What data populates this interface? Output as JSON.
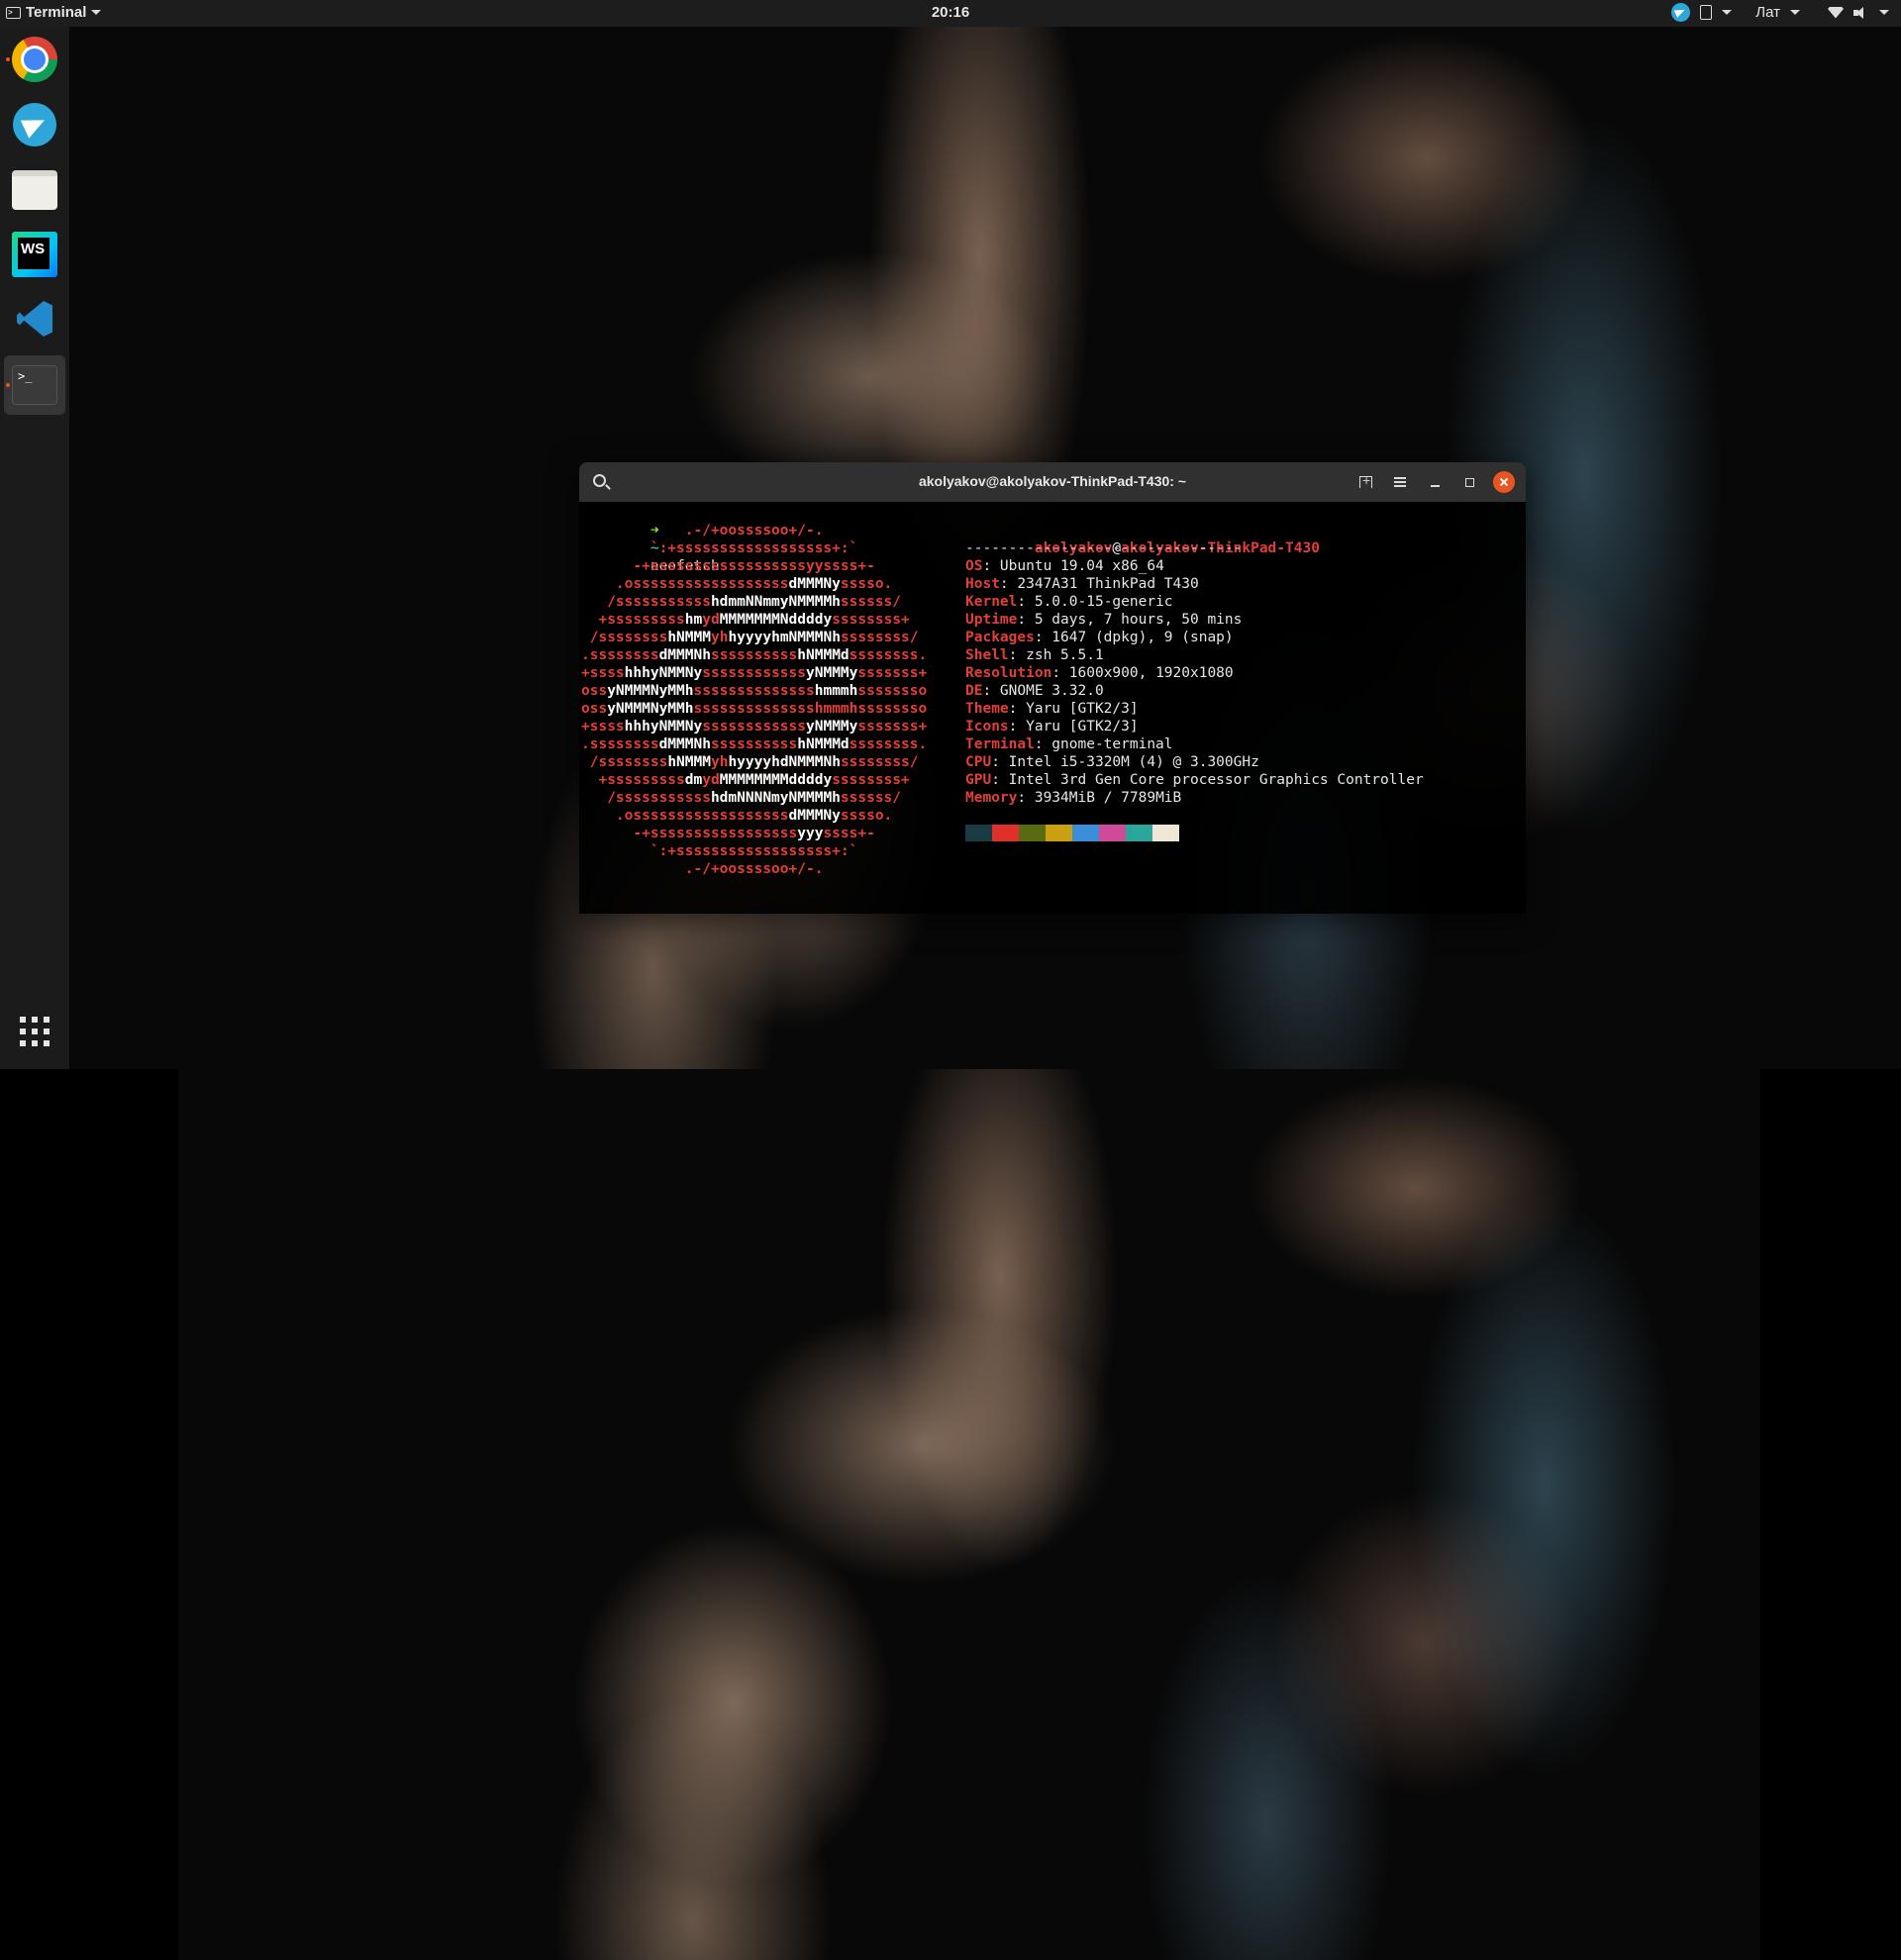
{
  "top_bar": {
    "app_menu_label": "Terminal",
    "clock": "20:16",
    "keyboard_layout": "Лат"
  },
  "dock": {
    "items": [
      "Google Chrome",
      "Telegram",
      "Files",
      "WebStorm",
      "Visual Studio Code",
      "Terminal"
    ],
    "webstorm_badge": "WS",
    "terminal_glyph": ">_"
  },
  "terminal": {
    "title": "akolyakov@akolyakov-ThinkPad-T430: ~",
    "prompt_arrow": "➜",
    "prompt_dir": "~",
    "command": "neofetch",
    "user": "akolyakov",
    "at": "@",
    "host": "akolyakov-ThinkPad-T430",
    "separator": "--------------------------------",
    "info": [
      {
        "key": "OS",
        "value": "Ubuntu 19.04 x86_64"
      },
      {
        "key": "Host",
        "value": "2347A31 ThinkPad T430"
      },
      {
        "key": "Kernel",
        "value": "5.0.0-15-generic"
      },
      {
        "key": "Uptime",
        "value": "5 days, 7 hours, 50 mins"
      },
      {
        "key": "Packages",
        "value": "1647 (dpkg), 9 (snap)"
      },
      {
        "key": "Shell",
        "value": "zsh 5.5.1"
      },
      {
        "key": "Resolution",
        "value": "1600x900, 1920x1080"
      },
      {
        "key": "DE",
        "value": "GNOME 3.32.0"
      },
      {
        "key": "Theme",
        "value": "Yaru [GTK2/3]"
      },
      {
        "key": "Icons",
        "value": "Yaru [GTK2/3]"
      },
      {
        "key": "Terminal",
        "value": "gnome-terminal"
      },
      {
        "key": "CPU",
        "value": "Intel i5-3320M (4) @ 3.300GHz"
      },
      {
        "key": "GPU",
        "value": "Intel 3rd Gen Core processor Graphics Controller"
      },
      {
        "key": "Memory",
        "value": "3934MiB / 7789MiB"
      }
    ],
    "palette": [
      "#1a3a44",
      "#e0302c",
      "#5a6a10",
      "#c9a010",
      "#3a8fd8",
      "#d04a9a",
      "#2aa79a",
      "#efe7d6"
    ],
    "logo": [
      "            .-/+oossssoo+/-.",
      "        `:+ssssssssssssssssss+:`",
      "      -+ssssssssssssssssssyyssss+-",
      "    .ossssssssssssssssss[dMMMNy]sssso.",
      "   /sssssssssss[hdmmNNmmyNMMMMh]ssssss/",
      "  +sssssssss[hm]{yd}[MMMMMMMNddddy]ssssssss+",
      " /ssssssss[hNMMM]{yh}[hyyyyhmNMMMNh]ssssssss/",
      ".ssssssss[dMMMNh]ssssssssss[hNMMMd]ssssssss.",
      "+ssss[hhhyNMMNy]ssssssssssss[yNMMMy]sssssss+",
      "oss[yNMMMNyMMh]ssssssssssssss[hmmmh]ssssssso",
      "oss[yNMMMNyMMh]sssssssssssssshmmmhssssssso",
      "+ssss[hhhyNMMNy]ssssssssssss[yNMMMy]sssssss+",
      ".ssssssss[dMMMNh]ssssssssss[hNMMMd]ssssssss.",
      " /ssssssss[hNMMM]{yh}[hyyyyhdNMMMNh]ssssssss/",
      "  +sssssssss[dm]{yd}[MMMMMMMMddddy]ssssssss+",
      "   /sssssssssss[hdmNNNNmyNMMMMh]ssssss/",
      "    .ossssssssssssssssss[dMMMNy]sssso.",
      "      -+sssssssssssssssss[yyy]ssss+-",
      "        `:+ssssssssssssssssss+:`",
      "            .-/+oossssoo+/-."
    ]
  }
}
